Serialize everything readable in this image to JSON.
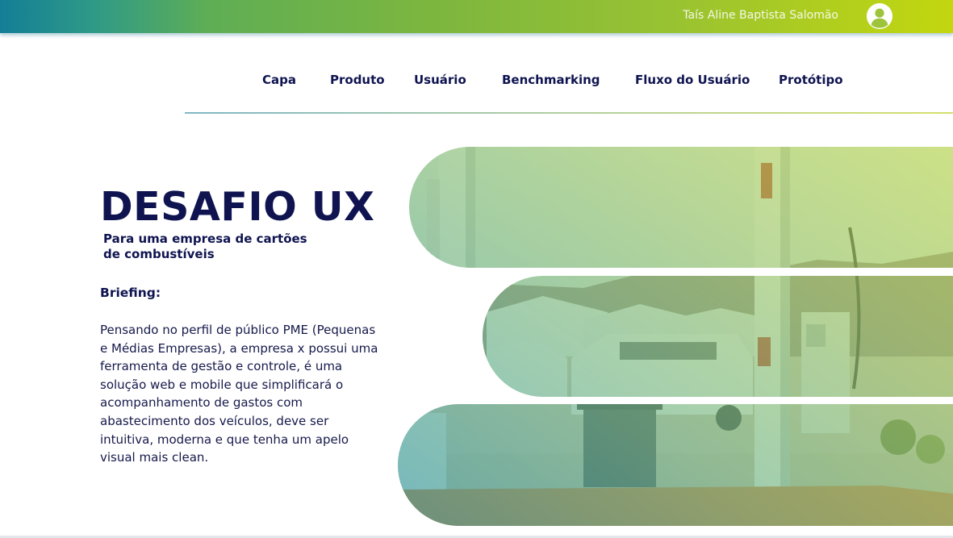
{
  "header": {
    "user_name": "Taís Aline Baptista Salomão",
    "avatar_icon": "user-circle-icon"
  },
  "nav": {
    "items": [
      {
        "label": "Capa"
      },
      {
        "label": "Produto"
      },
      {
        "label": "Usuário"
      },
      {
        "label": "Benchmarking"
      },
      {
        "label": "Fluxo do Usuário"
      },
      {
        "label": "Protótipo"
      }
    ]
  },
  "hero": {
    "title": "DESAFIO UX",
    "subtitle": "Para uma empresa de cartões de combustíveis",
    "briefing_label": "Briefing:",
    "briefing_text": "Pensando no perfil de público PME (Pequenas e Médias Empresas), a empresa x possui uma ferramenta de gestão e controle, é uma solução web e mobile que simplificará o acompanhamento de gastos com abastecimento dos veículos, deve ser intuitiva, moderna e que tenha um apelo visual mais clean."
  },
  "colors": {
    "navy": "#0f1450",
    "gradient_start": "#137e96",
    "gradient_end": "#c3d70f"
  }
}
